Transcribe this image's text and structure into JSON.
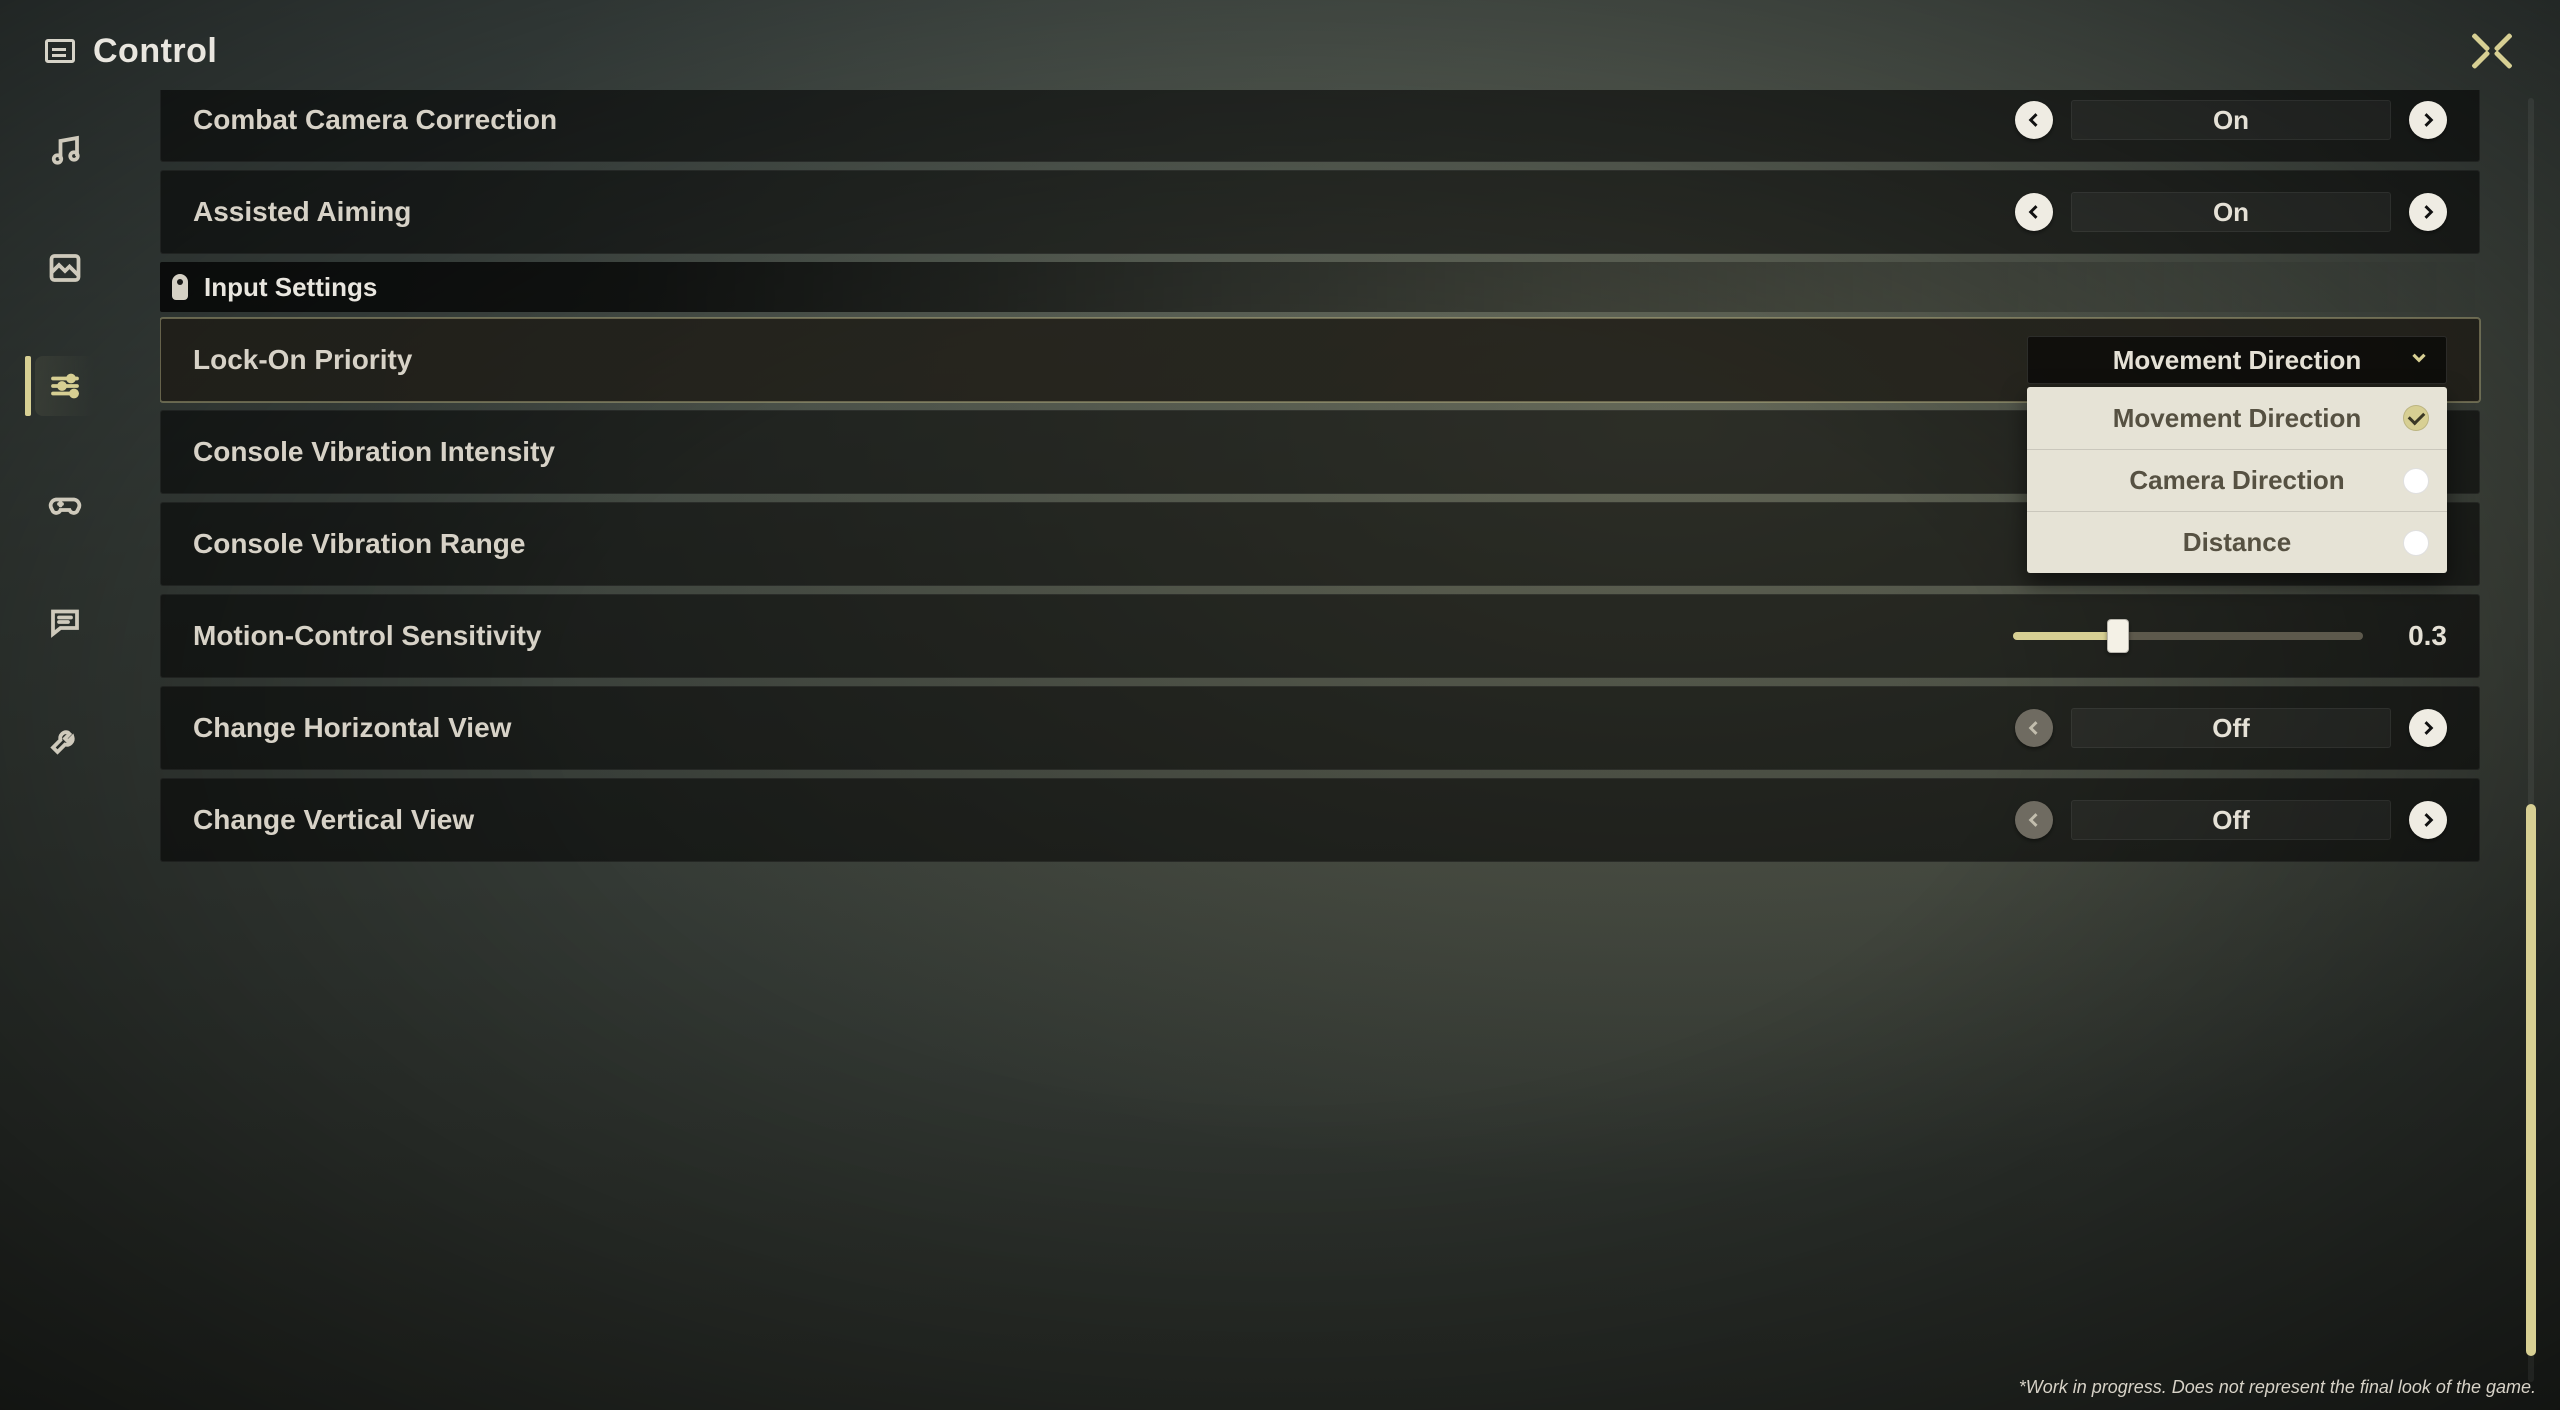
{
  "header": {
    "title": "Control"
  },
  "sidenav": {
    "items": [
      {
        "key": "audio"
      },
      {
        "key": "photo"
      },
      {
        "key": "settings",
        "active": true
      },
      {
        "key": "controller"
      },
      {
        "key": "chat"
      },
      {
        "key": "tools"
      }
    ]
  },
  "rows": [
    {
      "kind": "spinner",
      "label": "Combat Camera Correction",
      "value": "On",
      "left_enabled": true,
      "right_enabled": true
    },
    {
      "kind": "spinner",
      "label": "Assisted Aiming",
      "value": "On",
      "left_enabled": true,
      "right_enabled": true
    },
    {
      "kind": "section",
      "label": "Input Settings"
    },
    {
      "kind": "dropdown",
      "label": "Lock-On Priority",
      "value": "Movement Direction",
      "options": [
        "Movement Direction",
        "Camera Direction",
        "Distance"
      ],
      "selected_index": 0,
      "open": true,
      "highlight": true
    },
    {
      "kind": "hidden_label",
      "label": "Console Vibration Intensity"
    },
    {
      "kind": "hidden_label",
      "label": "Console Vibration Range"
    },
    {
      "kind": "slider",
      "label": "Motion-Control Sensitivity",
      "value": "0.3",
      "fraction": 0.3
    },
    {
      "kind": "spinner",
      "label": "Change Horizontal View",
      "value": "Off",
      "left_enabled": false,
      "right_enabled": true
    },
    {
      "kind": "spinner",
      "label": "Change Vertical View",
      "value": "Off",
      "left_enabled": false,
      "right_enabled": true
    }
  ],
  "scrollbar": {
    "top_pct": 55,
    "height_pct": 43
  },
  "disclaimer": "*Work in progress. Does not represent the final look of the game."
}
